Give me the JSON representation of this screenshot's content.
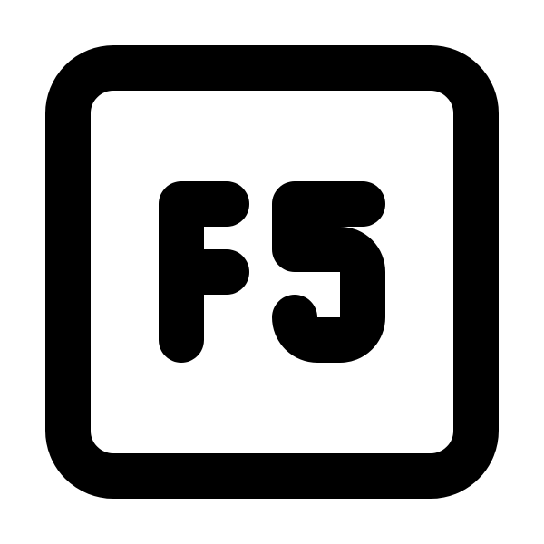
{
  "icon": {
    "name": "f5-key-icon",
    "label": "F5",
    "stroke_color": "#000000",
    "background_color": "#ffffff"
  }
}
